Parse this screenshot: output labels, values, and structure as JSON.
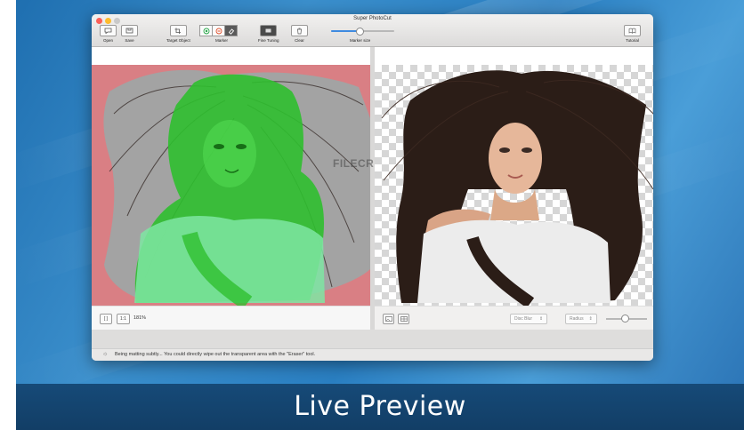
{
  "window": {
    "title": "Super PhotoCut"
  },
  "toolbar": {
    "open": "Open",
    "save": "Save",
    "target_object": "Target Object",
    "marker": "Marker",
    "fine_tuning": "Fine Tuning",
    "clear": "Clear",
    "marker_size": "Marker size",
    "marker_size_value": 0.45,
    "tutorial": "Tutorial"
  },
  "left_panel": {
    "fit_label": "[ ]",
    "actual_size": "1:1",
    "zoom": "181%"
  },
  "right_panel": {
    "blur_mode": "Disc Blur",
    "radius_label": "Radius",
    "radius_value": 0.4
  },
  "status": {
    "message": "Being matting subtly... You could directly wipe out the transparent area with the \"Eraser\" tool."
  },
  "watermark": "FILECR",
  "caption": "Live Preview",
  "colors": {
    "mask_green": "#2fbf2f",
    "mask_gray": "#9a9a9a",
    "bg_red": "#d97f84",
    "accent_blue": "#3f8be0",
    "desktop_blue": "#2a7fc2"
  }
}
